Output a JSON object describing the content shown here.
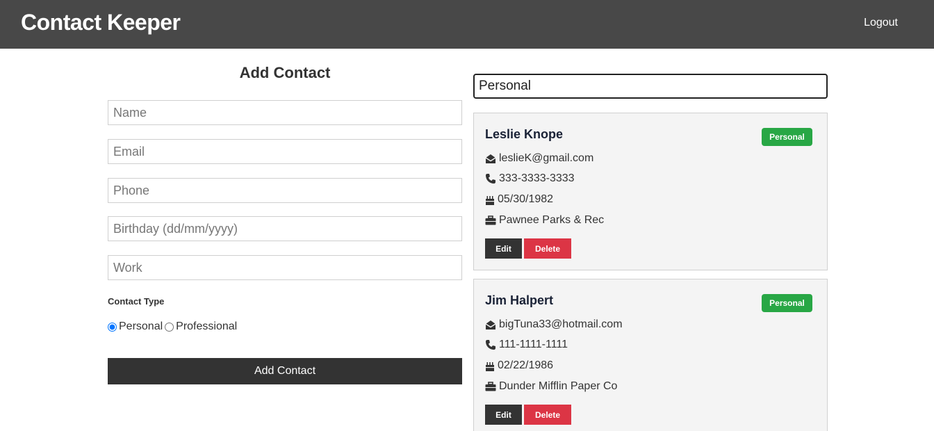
{
  "navbar": {
    "brand": "Contact Keeper",
    "logout_label": "Logout"
  },
  "form": {
    "title": "Add Contact",
    "fields": {
      "name_placeholder": "Name",
      "email_placeholder": "Email",
      "phone_placeholder": "Phone",
      "birthday_placeholder": "Birthday (dd/mm/yyyy)",
      "work_placeholder": "Work"
    },
    "contact_type_label": "Contact Type",
    "radio_personal": "Personal",
    "radio_professional": "Professional",
    "selected_type": "Personal",
    "submit_label": "Add Contact"
  },
  "filter": {
    "value": "Personal"
  },
  "contacts": [
    {
      "name": "Leslie Knope",
      "type": "Personal",
      "email": "leslieK@gmail.com",
      "phone": "333-3333-3333",
      "birthday": "05/30/1982",
      "work": "Pawnee Parks & Rec",
      "edit_label": "Edit",
      "delete_label": "Delete"
    },
    {
      "name": "Jim Halpert",
      "type": "Personal",
      "email": "bigTuna33@hotmail.com",
      "phone": "111-1111-1111",
      "birthday": "02/22/1986",
      "work": "Dunder Mifflin Paper Co",
      "edit_label": "Edit",
      "delete_label": "Delete"
    }
  ],
  "colors": {
    "navbar_bg": "#484848",
    "badge_personal": "#28a745",
    "delete_button": "#dc3545",
    "dark_button": "#333333"
  },
  "icons": [
    "envelope-open-icon",
    "phone-icon",
    "birthday-cake-icon",
    "briefcase-icon"
  ]
}
